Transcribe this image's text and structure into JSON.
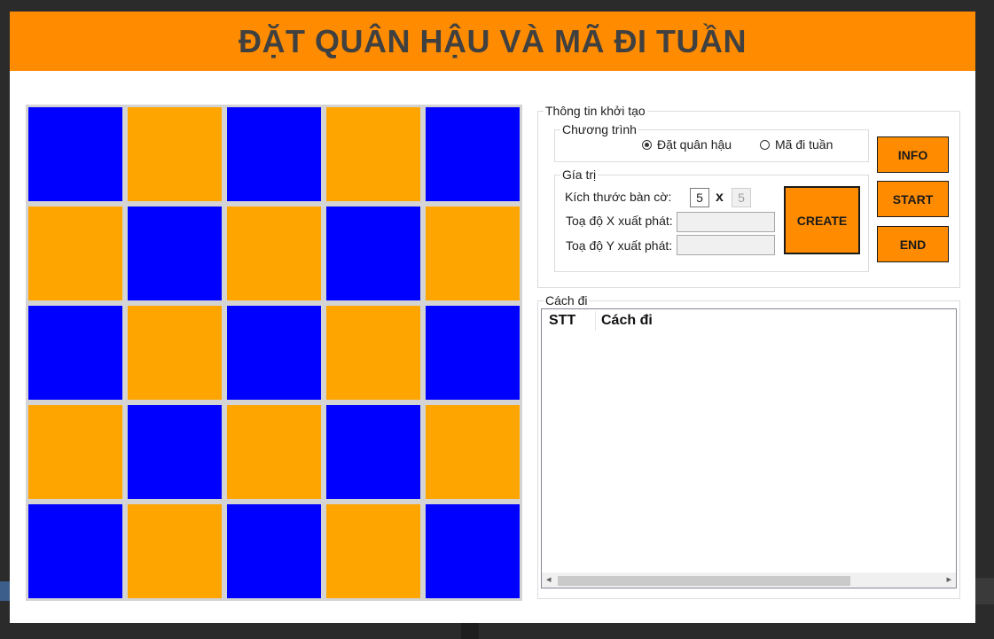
{
  "window": {
    "title": "ĐẶT QUÂN HẬU VÀ MÃ ĐI TUẦN"
  },
  "colors": {
    "accent": "#ff8c00",
    "board_blue": "#0000ff",
    "board_orange": "#ffa500"
  },
  "board": {
    "size": 5,
    "cells": [
      [
        "blue",
        "orange",
        "blue",
        "orange",
        "blue"
      ],
      [
        "orange",
        "blue",
        "orange",
        "blue",
        "orange"
      ],
      [
        "blue",
        "orange",
        "blue",
        "orange",
        "blue"
      ],
      [
        "orange",
        "blue",
        "orange",
        "blue",
        "orange"
      ],
      [
        "blue",
        "orange",
        "blue",
        "orange",
        "blue"
      ]
    ]
  },
  "init_group": {
    "legend": "Thông tin khởi tạo",
    "program": {
      "legend": "Chương trình",
      "options": [
        {
          "label": "Đặt quân hậu",
          "selected": true
        },
        {
          "label": "Mã đi tuần",
          "selected": false
        }
      ]
    },
    "values": {
      "legend": "Gía trị",
      "board_size_label": "Kích thước bàn cờ:",
      "board_size_a": "5",
      "times_symbol": "x",
      "board_size_b": "5",
      "start_x_label": "Toạ độ X xuất phát:",
      "start_x_value": "",
      "start_y_label": "Toạ độ Y xuất phát:",
      "start_y_value": ""
    },
    "create_label": "CREATE"
  },
  "buttons": {
    "info": "INFO",
    "start": "START",
    "end": "END"
  },
  "moves": {
    "legend": "Cách đi",
    "columns": [
      "STT",
      "Cách đi"
    ],
    "rows": []
  }
}
